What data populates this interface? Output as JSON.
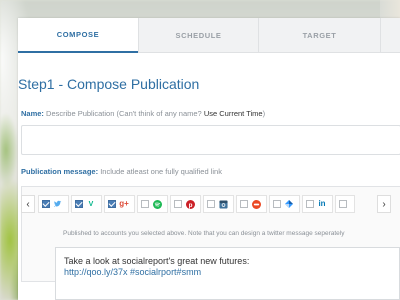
{
  "tabs": [
    {
      "label": "COMPOSE"
    },
    {
      "label": "SCHEDULE"
    },
    {
      "label": "TARGET"
    }
  ],
  "step_title": "Step1 - Compose Publication",
  "name_field": {
    "label": "Name:",
    "hint": "Describe Publication (Can't think of any name?",
    "link": "Use Current Time",
    "close": ")"
  },
  "message_field": {
    "label": "Publication message:",
    "hint": "Include atleast one fully qualified link"
  },
  "accounts": [
    {
      "icon": "twitter-icon",
      "checked": true,
      "color": "#55acee"
    },
    {
      "icon": "vine-icon",
      "checked": true,
      "color": "#00b488"
    },
    {
      "icon": "google-plus-icon",
      "checked": true,
      "color": "#dd4b39"
    },
    {
      "icon": "spotify-icon",
      "checked": false,
      "color": "#1db954"
    },
    {
      "icon": "pinterest-icon",
      "checked": false,
      "color": "#cb2027"
    },
    {
      "icon": "instagram-icon",
      "checked": false,
      "color": "#3f729b"
    },
    {
      "icon": "stumbleupon-icon",
      "checked": false,
      "color": "#eb4924"
    },
    {
      "icon": "delicious-icon",
      "checked": false,
      "color": "#3399ff"
    },
    {
      "icon": "linkedin-icon",
      "checked": false,
      "color": "#0077b5"
    }
  ],
  "note": "Published to accounts you selected above. Note that you can design a twitter message seperately",
  "message": {
    "line1": "Take a look at socialreport's great new futures:",
    "line2": "http://qoo.ly/37x #socialrport#smm"
  }
}
